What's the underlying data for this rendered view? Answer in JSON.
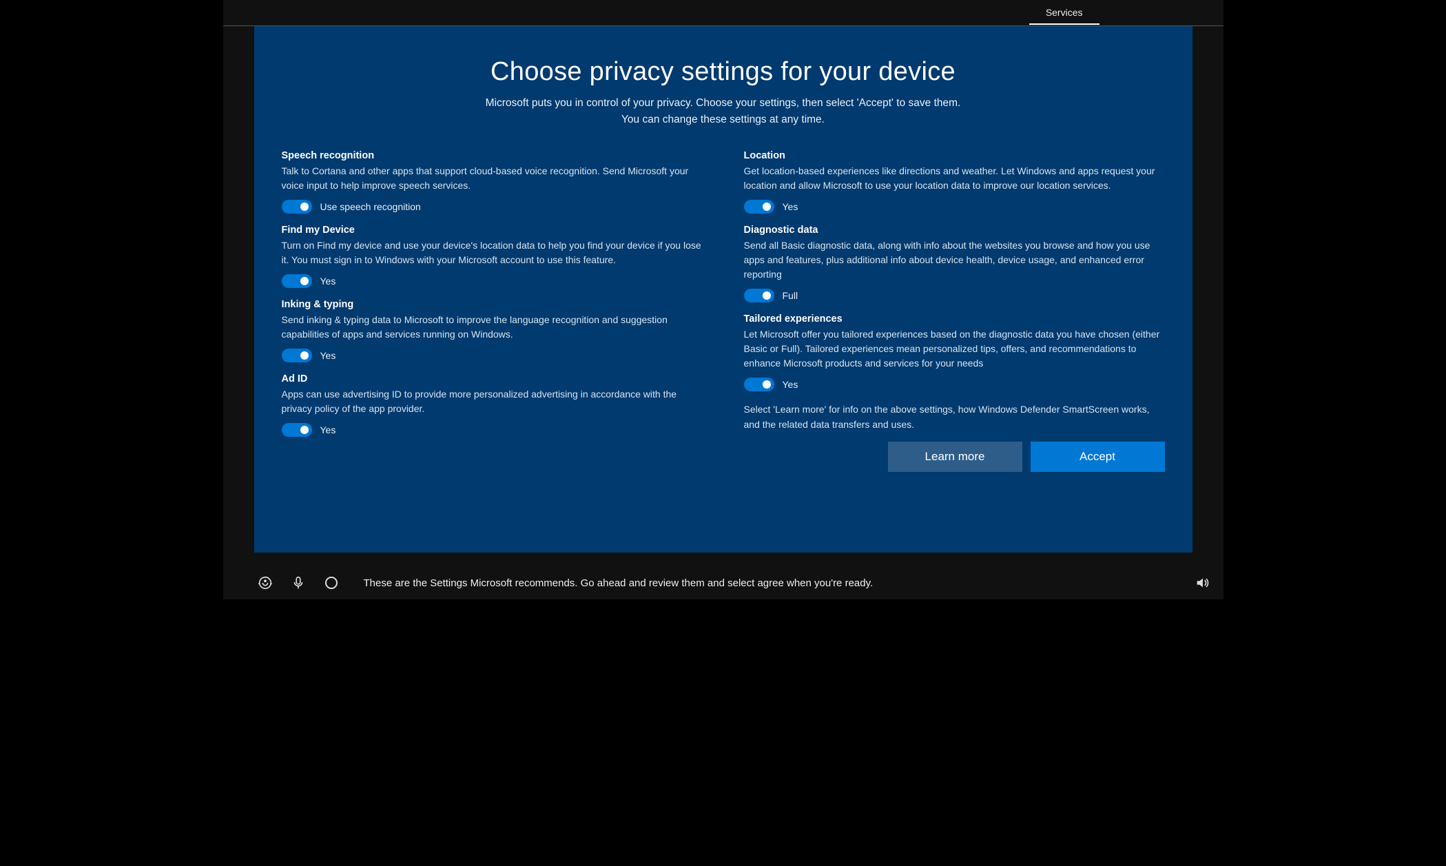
{
  "topbar": {
    "tab": "Services"
  },
  "header": {
    "title": "Choose privacy settings for your device",
    "subtitle_line1": "Microsoft puts you in control of your privacy. Choose your settings, then select 'Accept' to save them.",
    "subtitle_line2": "You can change these settings at any time."
  },
  "left": [
    {
      "title": "Speech recognition",
      "desc": "Talk to Cortana and other apps that support cloud-based voice recognition.  Send Microsoft your voice input to help improve speech services.",
      "toggle_label": "Use speech recognition"
    },
    {
      "title": "Find my Device",
      "desc": "Turn on Find my device and use your device's location data to help you find your device if you lose it. You must sign in to Windows with your Microsoft account to use this feature.",
      "toggle_label": "Yes"
    },
    {
      "title": "Inking & typing",
      "desc": "Send inking & typing data to Microsoft to improve the language recognition and suggestion capabilities of apps and services running on Windows.",
      "toggle_label": "Yes"
    },
    {
      "title": "Ad ID",
      "desc": "Apps can use advertising ID to provide more personalized advertising in accordance with the privacy policy of the app provider.",
      "toggle_label": "Yes"
    }
  ],
  "right": [
    {
      "title": "Location",
      "desc": "Get location-based experiences like directions and weather.  Let Windows and apps request your location and allow Microsoft to use your location data to improve our location services.",
      "toggle_label": "Yes"
    },
    {
      "title": "Diagnostic data",
      "desc": "Send all Basic diagnostic data, along with info about the websites you browse and how you use apps and features, plus additional info about device health, device usage, and enhanced error reporting",
      "toggle_label": "Full"
    },
    {
      "title": "Tailored experiences",
      "desc": "Let Microsoft offer you tailored experiences based on the diagnostic data you have chosen (either Basic or Full). Tailored experiences mean personalized tips, offers, and recommendations to enhance Microsoft products and services for your needs",
      "toggle_label": "Yes"
    }
  ],
  "footnote": "Select 'Learn more' for info on the above settings, how Windows Defender SmartScreen works, and the related data transfers and uses.",
  "buttons": {
    "learn_more": "Learn more",
    "accept": "Accept"
  },
  "bottombar": {
    "message": "These are the Settings Microsoft recommends. Go ahead and review them and select agree when you're ready."
  }
}
